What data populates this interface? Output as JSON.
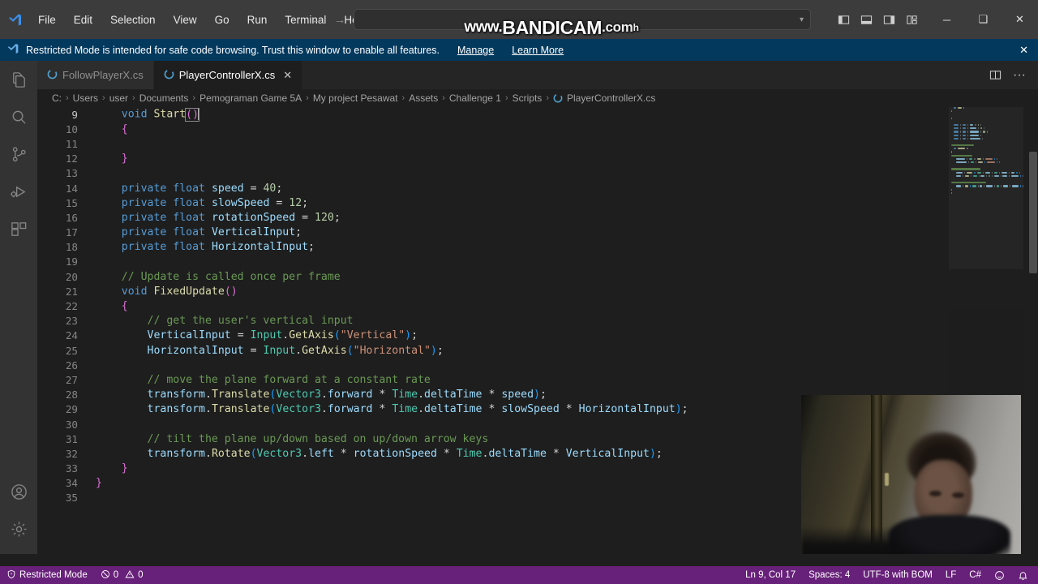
{
  "titlebar": {
    "logo_icon": "vscode-logo-icon",
    "menus": [
      "File",
      "Edit",
      "Selection",
      "View",
      "Go",
      "Run",
      "Terminal",
      "Help"
    ],
    "nav_back_icon": "arrow-left-icon",
    "nav_forward_icon": "arrow-right-icon",
    "command_center_value": "",
    "chevron_icon": "chevron-down-icon",
    "layout_icons": [
      "toggle-primary-sidebar-icon",
      "toggle-panel-icon",
      "toggle-secondary-sidebar-icon",
      "customize-layout-icon"
    ],
    "minimize_label": "─",
    "maximize_label": "❑",
    "close_label": "✕"
  },
  "notification": {
    "icon": "vscode-shield-icon",
    "message": "Restricted Mode is intended for safe code browsing. Trust this window to enable all features.",
    "manage_label": "Manage",
    "learn_more_label": "Learn More",
    "close_label": "✕"
  },
  "activitybar": {
    "items": [
      {
        "name": "explorer",
        "icon": "files-icon",
        "active": false
      },
      {
        "name": "search",
        "icon": "search-icon",
        "active": false
      },
      {
        "name": "source-control",
        "icon": "source-control-icon",
        "active": false
      },
      {
        "name": "run-and-debug",
        "icon": "run-debug-icon",
        "active": false
      },
      {
        "name": "extensions",
        "icon": "extensions-icon",
        "active": false
      }
    ],
    "bottom": [
      {
        "name": "accounts",
        "icon": "account-icon"
      },
      {
        "name": "manage",
        "icon": "gear-icon"
      }
    ]
  },
  "tabs": [
    {
      "label": "FollowPlayerX.cs",
      "icon": "csharp-icon",
      "active": false,
      "closable": false
    },
    {
      "label": "PlayerControllerX.cs",
      "icon": "csharp-icon",
      "active": true,
      "closable": true,
      "close_label": "✕"
    }
  ],
  "editor_actions": [
    {
      "name": "split-editor",
      "icon": "split-editor-icon"
    },
    {
      "name": "more-actions",
      "icon": "ellipsis-icon"
    }
  ],
  "breadcrumb": {
    "separator": "›",
    "items": [
      "C:",
      "Users",
      "user",
      "Documents",
      "Pemograman Game 5A",
      "My project Pesawat",
      "Assets",
      "Challenge 1",
      "Scripts"
    ],
    "file_icon": "csharp-icon",
    "file_label": "PlayerControllerX.cs"
  },
  "code": {
    "first_line": 9,
    "cursor_line": 9,
    "lines": [
      {
        "n": 9,
        "tokens": [
          {
            "t": "    ",
            "c": "plain"
          },
          {
            "t": "void ",
            "c": "kw"
          },
          {
            "t": "Start",
            "c": "fn"
          },
          {
            "t": "()",
            "c": "brk1",
            "box": true
          }
        ],
        "caret": true
      },
      {
        "n": 10,
        "tokens": [
          {
            "t": "    {",
            "c": "brk1"
          }
        ]
      },
      {
        "n": 11,
        "tokens": []
      },
      {
        "n": 12,
        "tokens": [
          {
            "t": "    }",
            "c": "brk1"
          }
        ]
      },
      {
        "n": 13,
        "tokens": []
      },
      {
        "n": 14,
        "tokens": [
          {
            "t": "    ",
            "c": "plain"
          },
          {
            "t": "private",
            "c": "kw"
          },
          {
            "t": " ",
            "c": "plain"
          },
          {
            "t": "float",
            "c": "kw"
          },
          {
            "t": " ",
            "c": "plain"
          },
          {
            "t": "speed",
            "c": "var"
          },
          {
            "t": " = ",
            "c": "pun"
          },
          {
            "t": "40",
            "c": "num"
          },
          {
            "t": ";",
            "c": "pun"
          }
        ]
      },
      {
        "n": 15,
        "tokens": [
          {
            "t": "    ",
            "c": "plain"
          },
          {
            "t": "private",
            "c": "kw"
          },
          {
            "t": " ",
            "c": "plain"
          },
          {
            "t": "float",
            "c": "kw"
          },
          {
            "t": " ",
            "c": "plain"
          },
          {
            "t": "slowSpeed",
            "c": "var"
          },
          {
            "t": " = ",
            "c": "pun"
          },
          {
            "t": "12",
            "c": "num"
          },
          {
            "t": ";",
            "c": "pun"
          }
        ]
      },
      {
        "n": 16,
        "tokens": [
          {
            "t": "    ",
            "c": "plain"
          },
          {
            "t": "private",
            "c": "kw"
          },
          {
            "t": " ",
            "c": "plain"
          },
          {
            "t": "float",
            "c": "kw"
          },
          {
            "t": " ",
            "c": "plain"
          },
          {
            "t": "rotationSpeed",
            "c": "var"
          },
          {
            "t": " = ",
            "c": "pun"
          },
          {
            "t": "120",
            "c": "num"
          },
          {
            "t": ";",
            "c": "pun"
          }
        ]
      },
      {
        "n": 17,
        "tokens": [
          {
            "t": "    ",
            "c": "plain"
          },
          {
            "t": "private",
            "c": "kw"
          },
          {
            "t": " ",
            "c": "plain"
          },
          {
            "t": "float",
            "c": "kw"
          },
          {
            "t": " ",
            "c": "plain"
          },
          {
            "t": "VerticalInput",
            "c": "var"
          },
          {
            "t": ";",
            "c": "pun"
          }
        ]
      },
      {
        "n": 18,
        "tokens": [
          {
            "t": "    ",
            "c": "plain"
          },
          {
            "t": "private",
            "c": "kw"
          },
          {
            "t": " ",
            "c": "plain"
          },
          {
            "t": "float",
            "c": "kw"
          },
          {
            "t": " ",
            "c": "plain"
          },
          {
            "t": "HorizontalInput",
            "c": "var"
          },
          {
            "t": ";",
            "c": "pun"
          }
        ]
      },
      {
        "n": 19,
        "tokens": []
      },
      {
        "n": 20,
        "tokens": [
          {
            "t": "    // Update is called once per frame",
            "c": "cmt"
          }
        ]
      },
      {
        "n": 21,
        "tokens": [
          {
            "t": "    ",
            "c": "plain"
          },
          {
            "t": "void ",
            "c": "kw"
          },
          {
            "t": "FixedUpdate",
            "c": "fn"
          },
          {
            "t": "()",
            "c": "brk1"
          }
        ]
      },
      {
        "n": 22,
        "tokens": [
          {
            "t": "    {",
            "c": "brk1"
          }
        ]
      },
      {
        "n": 23,
        "tokens": [
          {
            "t": "        // get the user's vertical input",
            "c": "cmt"
          }
        ]
      },
      {
        "n": 24,
        "tokens": [
          {
            "t": "        ",
            "c": "plain"
          },
          {
            "t": "VerticalInput",
            "c": "var"
          },
          {
            "t": " = ",
            "c": "pun"
          },
          {
            "t": "Input",
            "c": "typ"
          },
          {
            "t": ".",
            "c": "pun"
          },
          {
            "t": "GetAxis",
            "c": "fn"
          },
          {
            "t": "(",
            "c": "brk2"
          },
          {
            "t": "\"Vertical\"",
            "c": "str"
          },
          {
            "t": ")",
            "c": "brk2"
          },
          {
            "t": ";",
            "c": "pun"
          }
        ]
      },
      {
        "n": 25,
        "tokens": [
          {
            "t": "        ",
            "c": "plain"
          },
          {
            "t": "HorizontalInput",
            "c": "var"
          },
          {
            "t": " = ",
            "c": "pun"
          },
          {
            "t": "Input",
            "c": "typ"
          },
          {
            "t": ".",
            "c": "pun"
          },
          {
            "t": "GetAxis",
            "c": "fn"
          },
          {
            "t": "(",
            "c": "brk2"
          },
          {
            "t": "\"Horizontal\"",
            "c": "str"
          },
          {
            "t": ")",
            "c": "brk2"
          },
          {
            "t": ";",
            "c": "pun"
          }
        ]
      },
      {
        "n": 26,
        "tokens": []
      },
      {
        "n": 27,
        "tokens": [
          {
            "t": "        // move the plane forward at a constant rate",
            "c": "cmt"
          }
        ]
      },
      {
        "n": 28,
        "tokens": [
          {
            "t": "        ",
            "c": "plain"
          },
          {
            "t": "transform",
            "c": "var"
          },
          {
            "t": ".",
            "c": "pun"
          },
          {
            "t": "Translate",
            "c": "fn"
          },
          {
            "t": "(",
            "c": "brk2"
          },
          {
            "t": "Vector3",
            "c": "typ"
          },
          {
            "t": ".",
            "c": "pun"
          },
          {
            "t": "forward",
            "c": "var"
          },
          {
            "t": " * ",
            "c": "pun"
          },
          {
            "t": "Time",
            "c": "typ"
          },
          {
            "t": ".",
            "c": "pun"
          },
          {
            "t": "deltaTime",
            "c": "var"
          },
          {
            "t": " * ",
            "c": "pun"
          },
          {
            "t": "speed",
            "c": "var"
          },
          {
            "t": ")",
            "c": "brk2"
          },
          {
            "t": ";",
            "c": "pun"
          }
        ]
      },
      {
        "n": 29,
        "tokens": [
          {
            "t": "        ",
            "c": "plain"
          },
          {
            "t": "transform",
            "c": "var"
          },
          {
            "t": ".",
            "c": "pun"
          },
          {
            "t": "Translate",
            "c": "fn"
          },
          {
            "t": "(",
            "c": "brk2"
          },
          {
            "t": "Vector3",
            "c": "typ"
          },
          {
            "t": ".",
            "c": "pun"
          },
          {
            "t": "forward",
            "c": "var"
          },
          {
            "t": " * ",
            "c": "pun"
          },
          {
            "t": "Time",
            "c": "typ"
          },
          {
            "t": ".",
            "c": "pun"
          },
          {
            "t": "deltaTime",
            "c": "var"
          },
          {
            "t": " * ",
            "c": "pun"
          },
          {
            "t": "slowSpeed",
            "c": "var"
          },
          {
            "t": " * ",
            "c": "pun"
          },
          {
            "t": "HorizontalInput",
            "c": "var"
          },
          {
            "t": ")",
            "c": "brk2"
          },
          {
            "t": ";",
            "c": "pun"
          }
        ]
      },
      {
        "n": 30,
        "tokens": []
      },
      {
        "n": 31,
        "tokens": [
          {
            "t": "        // tilt the plane up/down based on up/down arrow keys",
            "c": "cmt"
          }
        ]
      },
      {
        "n": 32,
        "tokens": [
          {
            "t": "        ",
            "c": "plain"
          },
          {
            "t": "transform",
            "c": "var"
          },
          {
            "t": ".",
            "c": "pun"
          },
          {
            "t": "Rotate",
            "c": "fn"
          },
          {
            "t": "(",
            "c": "brk2"
          },
          {
            "t": "Vector3",
            "c": "typ"
          },
          {
            "t": ".",
            "c": "pun"
          },
          {
            "t": "left",
            "c": "var"
          },
          {
            "t": " * ",
            "c": "pun"
          },
          {
            "t": "rotationSpeed",
            "c": "var"
          },
          {
            "t": " * ",
            "c": "pun"
          },
          {
            "t": "Time",
            "c": "typ"
          },
          {
            "t": ".",
            "c": "pun"
          },
          {
            "t": "deltaTime",
            "c": "var"
          },
          {
            "t": " * ",
            "c": "pun"
          },
          {
            "t": "VerticalInput",
            "c": "var"
          },
          {
            "t": ")",
            "c": "brk2"
          },
          {
            "t": ";",
            "c": "pun"
          }
        ]
      },
      {
        "n": 33,
        "tokens": [
          {
            "t": "    }",
            "c": "brk1"
          }
        ]
      },
      {
        "n": 34,
        "tokens": [
          {
            "t": "}",
            "c": "brk1"
          }
        ]
      },
      {
        "n": 35,
        "tokens": []
      }
    ]
  },
  "statusbar": {
    "restricted_icon": "shield-icon",
    "restricted_label": "Restricted Mode",
    "error_icon": "error-circle-icon",
    "error_count": "0",
    "warning_icon": "warning-triangle-icon",
    "warning_count": "0",
    "cursor_position": "Ln 9, Col 17",
    "indentation": "Spaces: 4",
    "encoding": "UTF-8 with BOM",
    "eol": "LF",
    "language": "C#",
    "feedback_icon": "smiley-icon",
    "notifications_icon": "bell-icon"
  },
  "watermark": {
    "prefix": "www.",
    "brand": "BANDICAM",
    "suffix": ".com",
    "tail": "h"
  },
  "colors": {
    "titlebar_bg": "#3c3c3c",
    "notification_bg": "#04395e",
    "activitybar_bg": "#333333",
    "editor_bg": "#1e1e1e",
    "tabbar_bg": "#252526",
    "statusbar_bg": "#68217a",
    "accent": "#007acc"
  }
}
